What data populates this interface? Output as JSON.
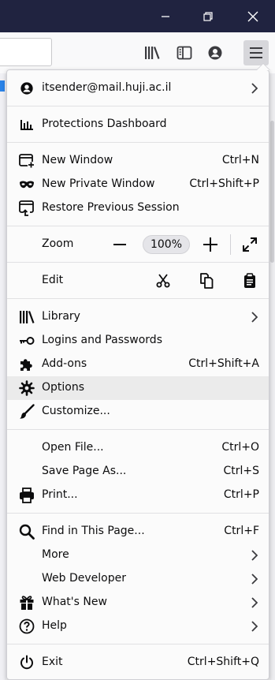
{
  "window": {
    "minimize_icon": "minimize-icon",
    "restore_icon": "restore-icon",
    "close_icon": "close-icon",
    "titlebar_color": "#202340"
  },
  "toolbar": {
    "icons": [
      "library-icon",
      "sidebar-icon",
      "account-icon",
      "hamburger-menu-icon"
    ]
  },
  "menu": {
    "account": {
      "label": "itsender@mail.huji.ac.il"
    },
    "protections": {
      "label": "Protections Dashboard"
    },
    "new_window": {
      "label": "New Window",
      "shortcut": "Ctrl+N"
    },
    "new_private_window": {
      "label": "New Private Window",
      "shortcut": "Ctrl+Shift+P"
    },
    "restore_session": {
      "label": "Restore Previous Session"
    },
    "zoom": {
      "label": "Zoom",
      "minus": "−",
      "value": "100%",
      "plus": "+"
    },
    "edit": {
      "label": "Edit"
    },
    "library": {
      "label": "Library"
    },
    "logins": {
      "label": "Logins and Passwords"
    },
    "addons": {
      "label": "Add-ons",
      "shortcut": "Ctrl+Shift+A"
    },
    "options": {
      "label": "Options"
    },
    "customize": {
      "label": "Customize..."
    },
    "open_file": {
      "label": "Open File...",
      "shortcut": "Ctrl+O"
    },
    "save_page": {
      "label": "Save Page As...",
      "shortcut": "Ctrl+S"
    },
    "print": {
      "label": "Print...",
      "shortcut": "Ctrl+P"
    },
    "find": {
      "label": "Find in This Page...",
      "shortcut": "Ctrl+F"
    },
    "more": {
      "label": "More"
    },
    "web_developer": {
      "label": "Web Developer"
    },
    "whats_new": {
      "label": "What's New"
    },
    "help": {
      "label": "Help"
    },
    "exit": {
      "label": "Exit",
      "shortcut": "Ctrl+Shift+Q"
    }
  }
}
